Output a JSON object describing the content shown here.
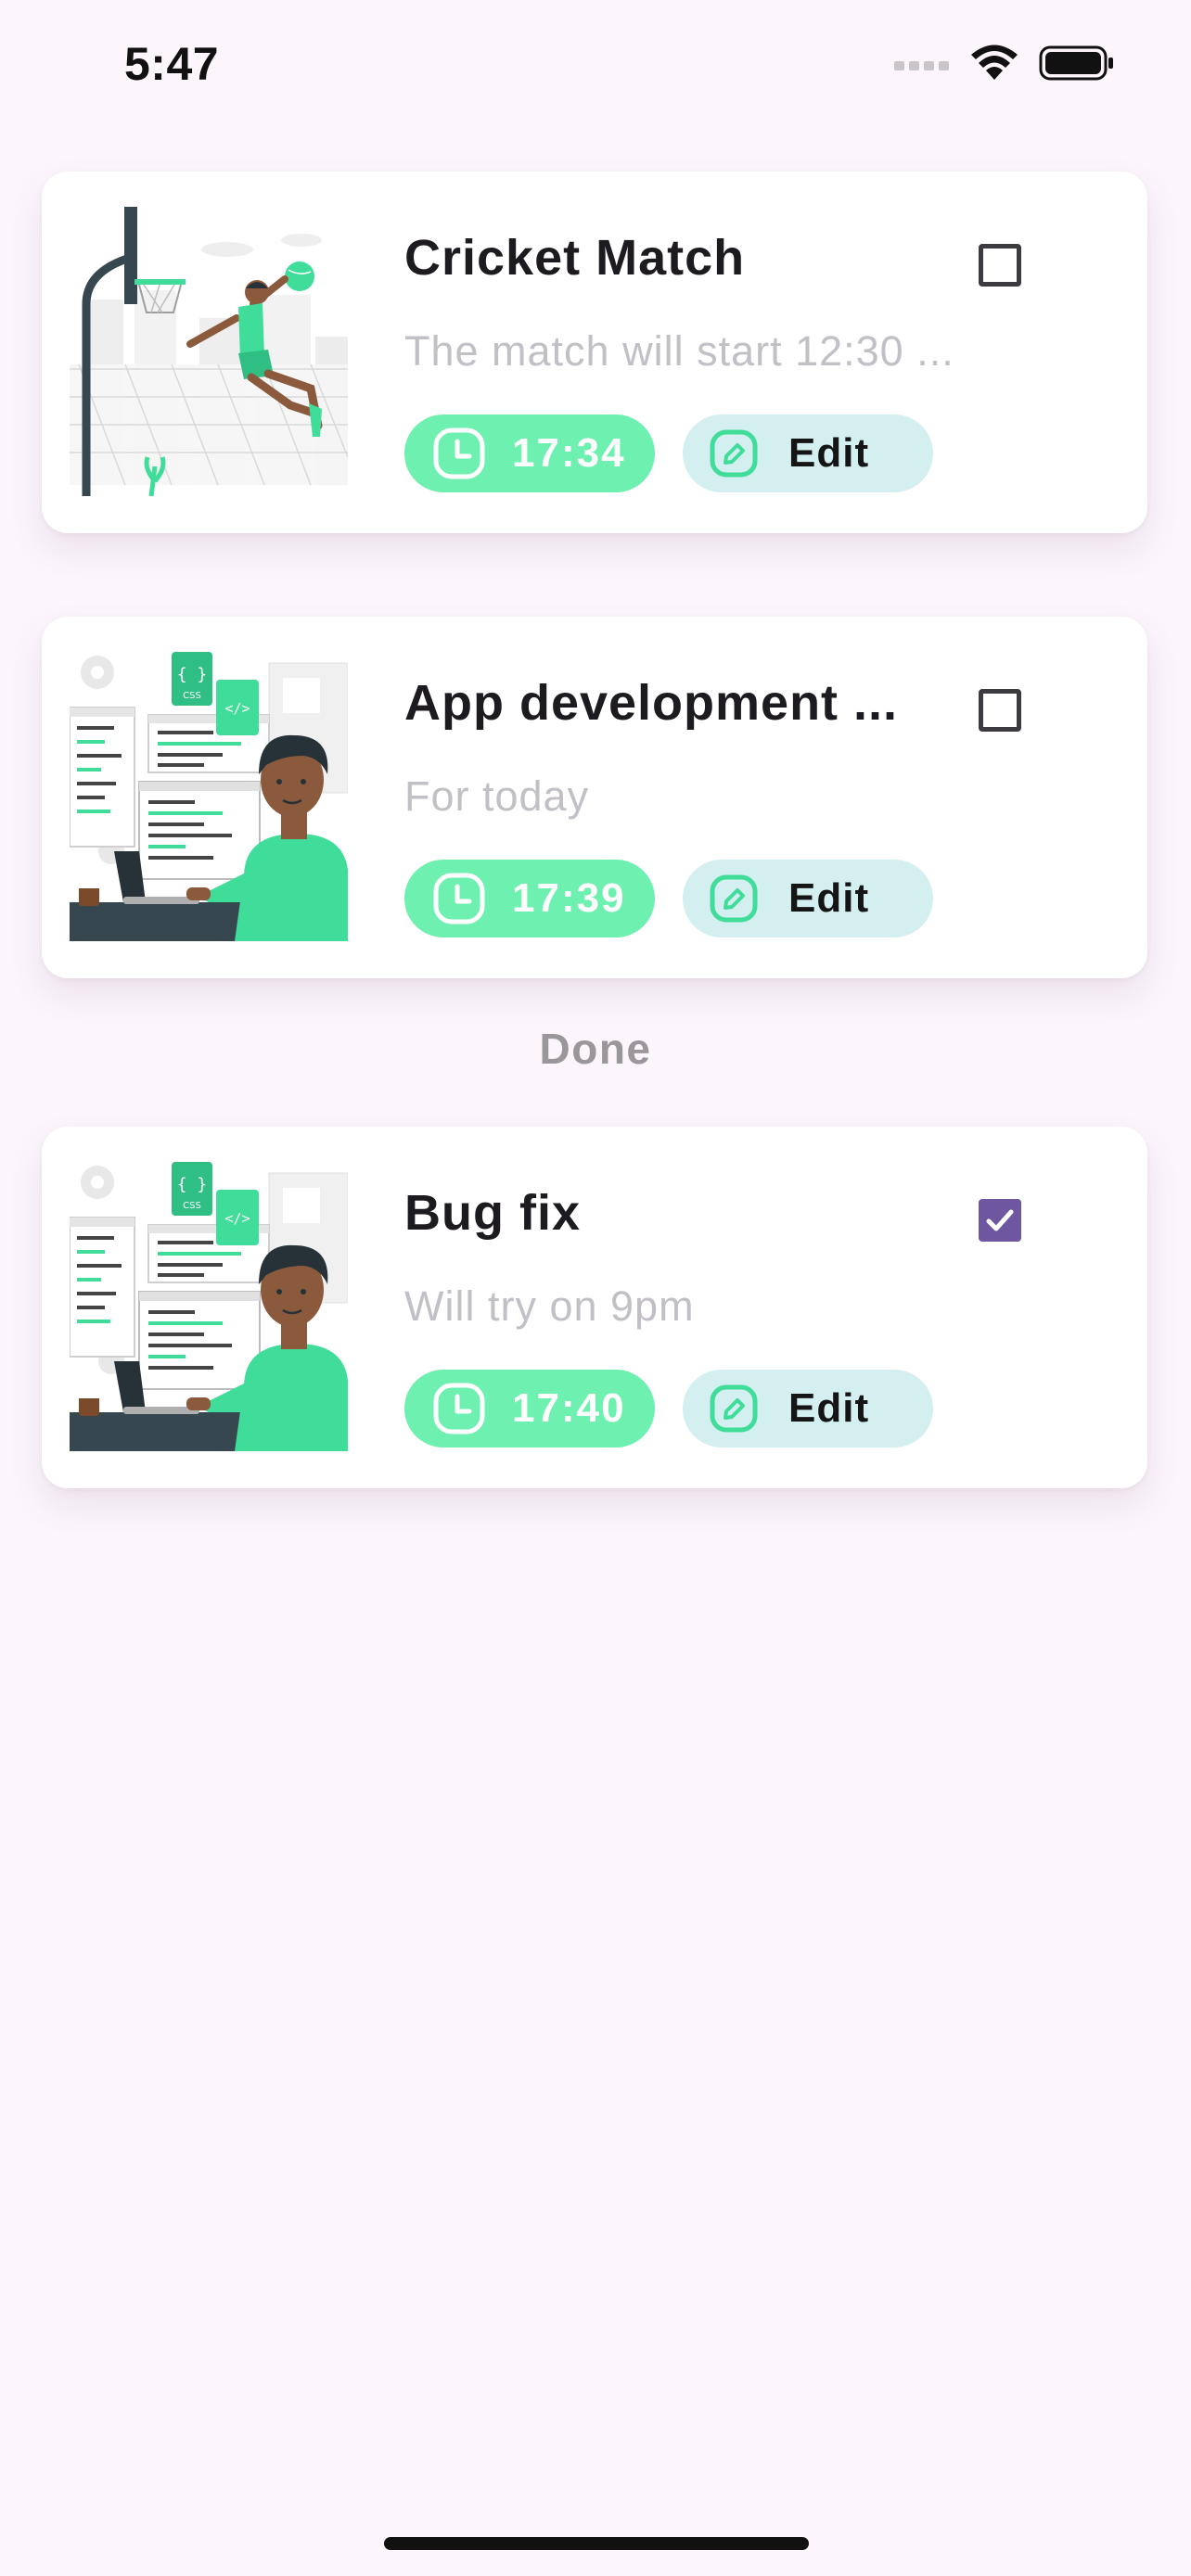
{
  "status_bar": {
    "time": "5:47"
  },
  "colors": {
    "background": "#fcf5fc",
    "time_chip": "#6ef0b0",
    "edit_chip": "#d4eff0",
    "checkbox_checked": "#6e57a0",
    "accent_green": "#3fdc9a"
  },
  "tasks": [
    {
      "title": "Cricket Match",
      "description": "The match will start 12:30 ...",
      "time": "17:34",
      "edit_label": "Edit",
      "done": false,
      "illustration": "basketball-player-illustration"
    },
    {
      "title": "App development ...",
      "description": "For today",
      "time": "17:39",
      "edit_label": "Edit",
      "done": false,
      "illustration": "developer-at-laptop-illustration"
    }
  ],
  "done_section": {
    "header": "Done",
    "tasks": [
      {
        "title": "Bug fix",
        "description": "Will try on 9pm",
        "time": "17:40",
        "edit_label": "Edit",
        "done": true,
        "illustration": "developer-at-laptop-illustration"
      }
    ]
  }
}
